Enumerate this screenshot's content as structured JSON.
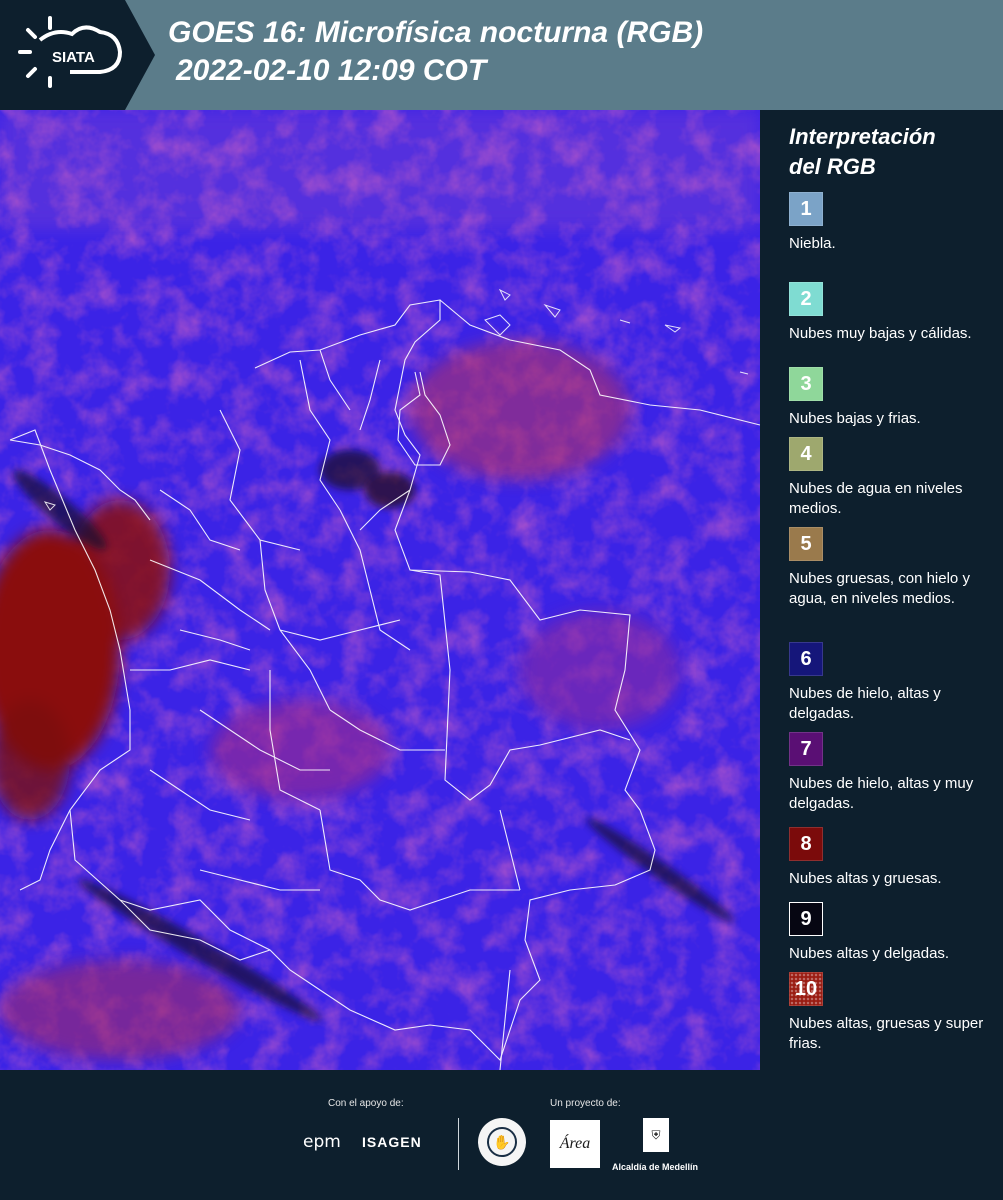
{
  "header": {
    "logo_text": "SIATA",
    "title_line1": "GOES 16: Microfísica nocturna (RGB)",
    "title_line2": "2022-02-10 12:09 COT"
  },
  "legend": {
    "title_line1": "Interpretación",
    "title_line2": "del RGB",
    "items": [
      {
        "number": "1",
        "label": "Niebla.",
        "color": "#7ba3c7"
      },
      {
        "number": "2",
        "label": "Nubes muy bajas y cálidas.",
        "color": "#7fdcd2"
      },
      {
        "number": "3",
        "label": "Nubes bajas y frias.",
        "color": "#8fd79a"
      },
      {
        "number": "4",
        "label": "Nubes de agua en niveles medios.",
        "color": "#9ea86e"
      },
      {
        "number": "5",
        "label": "Nubes gruesas, con hielo y agua, en niveles medios.",
        "color": "#9a7a4c"
      },
      {
        "number": "6",
        "label": "Nubes de hielo, altas y delgadas.",
        "color": "#15167a"
      },
      {
        "number": "7",
        "label": "Nubes de hielo, altas y muy delgadas.",
        "color": "#5a0f74"
      },
      {
        "number": "8",
        "label": "Nubes altas y gruesas.",
        "color": "#7b0b0b"
      },
      {
        "number": "9",
        "label": "Nubes altas y delgadas.",
        "color": "#060612"
      },
      {
        "number": "10",
        "label": "Nubes altas, gruesas y super frias.",
        "color": "#9a1c12"
      }
    ]
  },
  "footer": {
    "support_label": "Con el apoyo de:",
    "project_label": "Un proyecto de:",
    "epm": "epm",
    "isagen": "ISAGEN",
    "area_logo": "Área",
    "alcaldia": "Alcaldía de Medellín"
  },
  "colors": {
    "header_bg": "#5b7c8a",
    "panel_bg": "#0d1f2d",
    "map_blue": "#3b23e6",
    "map_red": "#8a0f0f",
    "map_magenta": "#a02a8a",
    "border_line": "#ffffff"
  }
}
